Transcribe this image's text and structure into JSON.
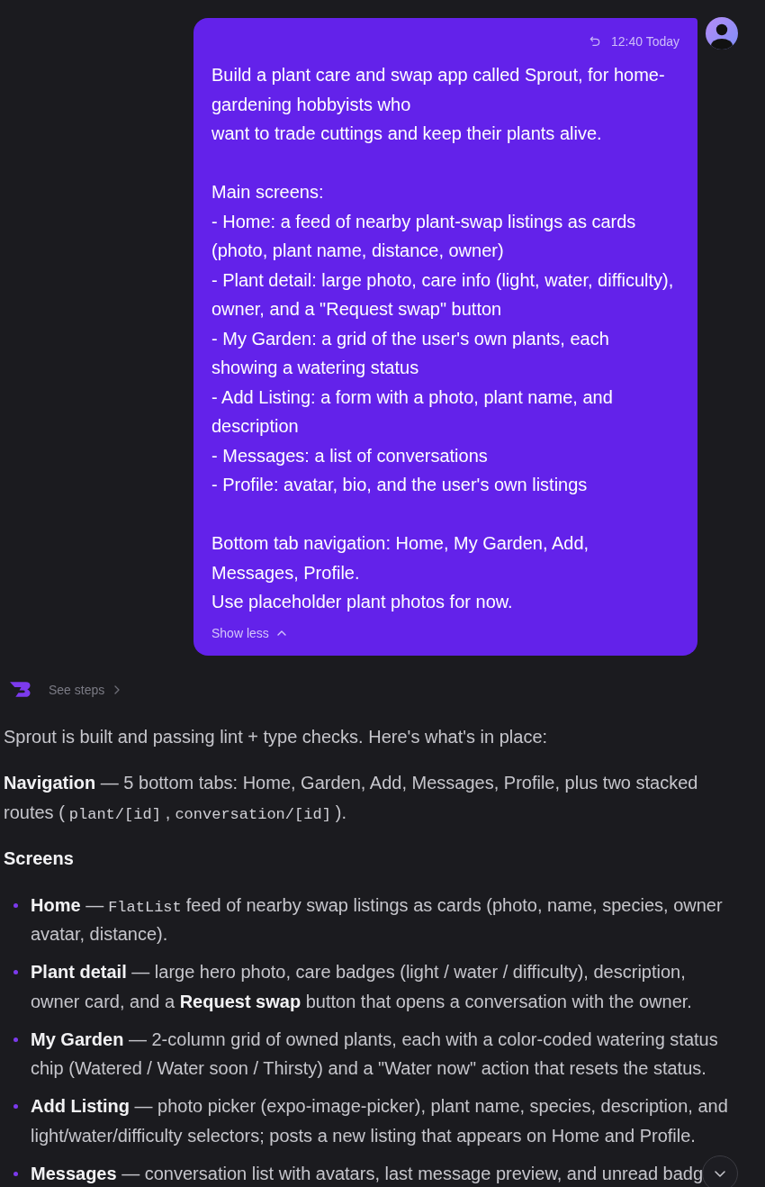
{
  "message": {
    "time": "12:40 Today",
    "paragraphs": [
      [
        "Build a plant care and swap app called Sprout, for home-gardening hobbyists who",
        "want to trade cuttings and keep their plants alive."
      ],
      [
        "Main screens:",
        "- Home: a feed of nearby plant-swap listings as cards (photo, plant name, distance, owner)",
        "- Plant detail: large photo, care info (light, water, difficulty), owner, and a \"Request swap\" button",
        "- My Garden: a grid of the user's own plants, each showing a watering status",
        "- Add Listing: a form with a photo, plant name, and description",
        "- Messages: a list of conversations",
        "- Profile: avatar, bio, and the user's own listings"
      ],
      [
        "Bottom tab navigation: Home, My Garden, Add, Messages, Profile.",
        "Use placeholder plant photos for now."
      ]
    ],
    "toggle": "Show less",
    "expanded": true
  },
  "steps": {
    "label": "See steps"
  },
  "response": {
    "blocks": [
      {
        "kind": "paragraph",
        "segments": [
          {
            "kind": "text",
            "text": "Sprout is built and passing lint + type checks. Here's what's in place:"
          }
        ]
      },
      {
        "kind": "paragraph",
        "segments": [
          {
            "kind": "text",
            "text": "**Navigation** — 5 bottom tabs: Home, Garden, Add, Messages, Profile, plus two stacked routes ("
          },
          {
            "kind": "code",
            "text": "plant/[id]"
          },
          {
            "kind": "text",
            "text": ","
          },
          {
            "kind": "code",
            "text": "conversation/[id]"
          },
          {
            "kind": "text",
            "text": ")."
          }
        ]
      },
      {
        "kind": "heading",
        "text": "Screens"
      },
      {
        "kind": "list",
        "items": [
          {
            "segments": [
              {
                "kind": "text",
                "text": "**Home** —"
              },
              {
                "kind": "code",
                "text": "FlatList"
              },
              {
                "kind": "text",
                "text": "feed of nearby swap listings as cards (photo, name, species, owner avatar, distance)."
              }
            ]
          },
          {
            "segments": [
              {
                "kind": "text",
                "text": "**Plant detail** — large hero photo, care badges (light / water / difficulty), description, owner card, and a **Request swap** button that opens a conversation with the owner."
              }
            ]
          },
          {
            "segments": [
              {
                "kind": "text",
                "text": "**My Garden** — 2-column grid of owned plants, each with a color-coded watering status chip (Watered / Water soon / Thirsty) and a \"Water now\" action that resets the status."
              }
            ]
          },
          {
            "segments": [
              {
                "kind": "text",
                "text": "**Add Listing** — photo picker (expo-image-picker), plant name, species, description, and light/water/difficulty selectors; posts a new listing that appears on Home and Profile."
              }
            ]
          },
          {
            "segments": [
              {
                "kind": "text",
                "text": "**Messages** — conversation list with avatars, last message preview, and unread badg"
              }
            ]
          }
        ]
      }
    ]
  }
}
